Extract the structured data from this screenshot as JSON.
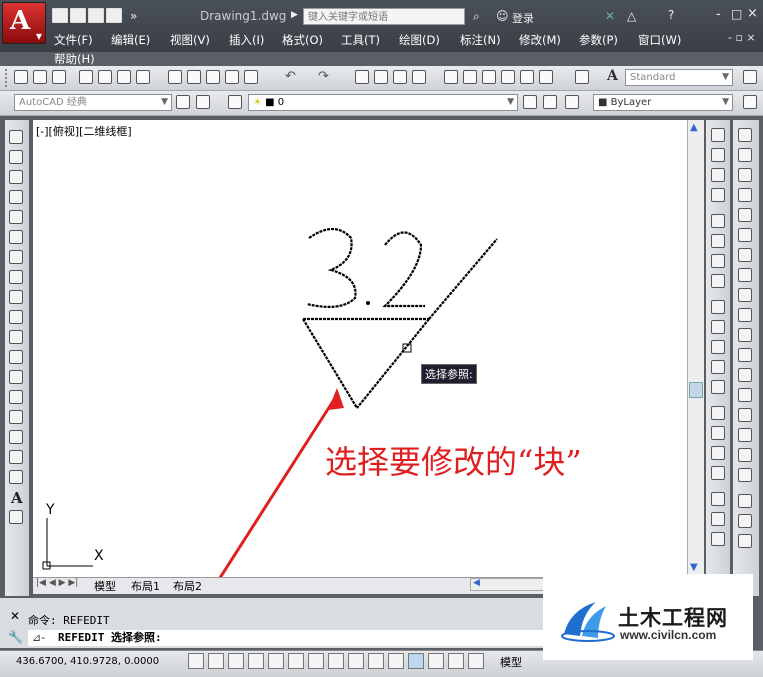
{
  "window": {
    "doc_title": "Drawing1.dwg",
    "search_placeholder": "键入关键字或短语",
    "login_label": "登录",
    "win_controls": [
      "-",
      "□",
      "×"
    ]
  },
  "menu": [
    "文件(F)",
    "编辑(E)",
    "视图(V)",
    "插入(I)",
    "格式(O)",
    "工具(T)",
    "绘图(D)",
    "标注(N)",
    "修改(M)",
    "参数(P)",
    "窗口(W)",
    "帮助(H)"
  ],
  "toolbar": {
    "workspace": "AutoCAD 经典",
    "layer": "0",
    "textstyle": "Standard",
    "bylayer": "ByLayer"
  },
  "viewport": {
    "label": "[-][俯视][二维线框]"
  },
  "drawing": {
    "text": "3.2",
    "tooltip": "选择参照:",
    "ucs_x": "X",
    "ucs_y": "Y"
  },
  "annotation": "选择要修改的“块”",
  "layout_tabs": [
    "模型",
    "布局1",
    "布局2"
  ],
  "command": {
    "history": "命令: REFEDIT",
    "current": "REFEDIT 选择参照:"
  },
  "status": {
    "coords": "436.6700, 410.9728, 0.0000",
    "model": "模型"
  },
  "watermark": {
    "name": "土木工程网",
    "url": "www.civilcn.com"
  },
  "colors": {
    "accent": "#e02020",
    "title": "#3a3f46"
  }
}
